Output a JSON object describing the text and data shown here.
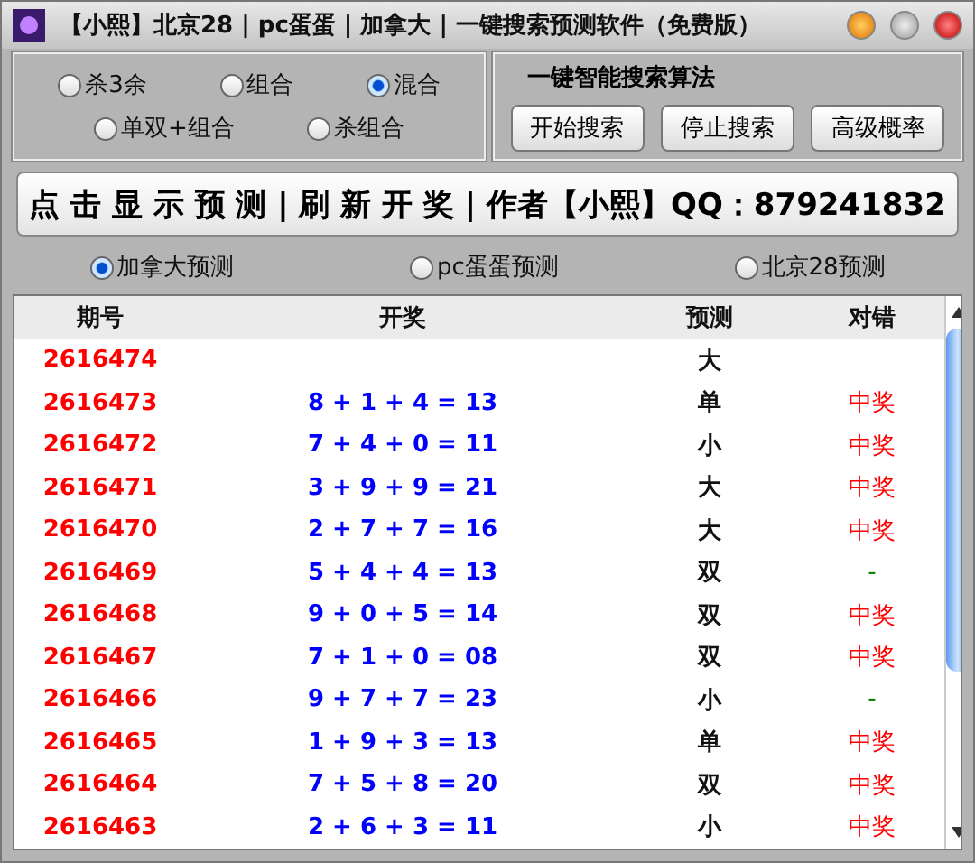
{
  "window": {
    "title": "【小熙】北京28 | pc蛋蛋 | 加拿大 | 一键搜索预测软件（免费版）"
  },
  "modes": [
    {
      "label": "杀3余",
      "selected": false
    },
    {
      "label": "组合",
      "selected": false
    },
    {
      "label": "混合",
      "selected": true
    },
    {
      "label": "单双+组合",
      "selected": false
    },
    {
      "label": "杀组合",
      "selected": false
    }
  ],
  "search_group": {
    "title": "一键智能搜索算法",
    "buttons": [
      "开始搜索",
      "停止搜索",
      "高级概率"
    ]
  },
  "banner_button": "点 击 显 示 预 测 | 刷 新 开 奖 | 作者【小熙】QQ：879241832",
  "sources": [
    {
      "label": "加拿大预测",
      "selected": true
    },
    {
      "label": "pc蛋蛋预测",
      "selected": false
    },
    {
      "label": "北京28预测",
      "selected": false
    }
  ],
  "table": {
    "columns": [
      "期号",
      "开奖",
      "预测",
      "对错"
    ],
    "rows": [
      {
        "issue": "2616474",
        "draw": "",
        "prediction": "大"
      },
      {
        "issue": "2616473",
        "draw": "8 + 1 + 4 = 13",
        "prediction": "单",
        "result": {
          "text": "中奖",
          "color": "#ff0000"
        }
      },
      {
        "issue": "2616472",
        "draw": "7 + 4 + 0 = 11",
        "prediction": "小",
        "result": {
          "text": "中奖",
          "color": "#ff0000"
        }
      },
      {
        "issue": "2616471",
        "draw": "3 + 9 + 9 = 21",
        "prediction": "大",
        "result": {
          "text": "中奖",
          "color": "#ff0000"
        }
      },
      {
        "issue": "2616470",
        "draw": "2 + 7 + 7 = 16",
        "prediction": "大",
        "result": {
          "text": "中奖",
          "color": "#ff0000"
        }
      },
      {
        "issue": "2616469",
        "draw": "5 + 4 + 4 = 13",
        "prediction": "双",
        "result": {
          "text": "-",
          "color": "#008000"
        }
      },
      {
        "issue": "2616468",
        "draw": "9 + 0 + 5 = 14",
        "prediction": "双",
        "result": {
          "text": "中奖",
          "color": "#ff0000"
        }
      },
      {
        "issue": "2616467",
        "draw": "7 + 1 + 0 = 08",
        "prediction": "双",
        "result": {
          "text": "中奖",
          "color": "#ff0000"
        }
      },
      {
        "issue": "2616466",
        "draw": "9 + 7 + 7 = 23",
        "prediction": "小",
        "result": {
          "text": "-",
          "color": "#008000"
        }
      },
      {
        "issue": "2616465",
        "draw": "1 + 9 + 3 = 13",
        "prediction": "单",
        "result": {
          "text": "中奖",
          "color": "#ff0000"
        }
      },
      {
        "issue": "2616464",
        "draw": "7 + 5 + 8 = 20",
        "prediction": "双",
        "result": {
          "text": "中奖",
          "color": "#ff0000"
        }
      },
      {
        "issue": "2616463",
        "draw": "2 + 6 + 3 = 11",
        "prediction": "小",
        "result": {
          "text": "中奖",
          "color": "#ff0000"
        }
      }
    ]
  }
}
